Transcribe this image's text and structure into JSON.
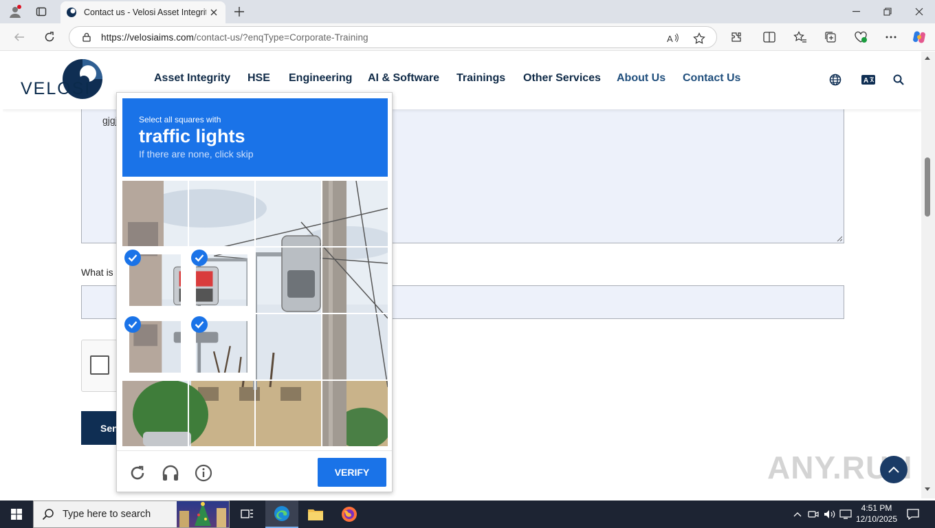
{
  "browser": {
    "tab_title": "Contact us - Velosi Asset Integrity",
    "url_host": "https://velosiaims.com",
    "url_path": "/contact-us/?enqType=Corporate-Training"
  },
  "site": {
    "logo_text": "VELOSI",
    "nav": [
      "Asset Integrity",
      "HSE",
      "Engineering",
      "AI & Software",
      "Trainings",
      "Other Services",
      "About Us",
      "Contact Us"
    ],
    "message_value": "gjgj",
    "question_label": "What is",
    "send_label": "Sen"
  },
  "captcha": {
    "instruction_small": "Select all squares with",
    "instruction_big": "traffic lights",
    "instruction_sub": "If there are none, click skip",
    "verify_label": "VERIFY",
    "selected_tiles": [
      4,
      5,
      8,
      9
    ]
  },
  "taskbar": {
    "search_placeholder": "Type here to search",
    "time": "4:51 PM",
    "date": "12/10/2025"
  },
  "watermark": "ANY.RUN",
  "colors": {
    "brand_navy": "#0f2e53",
    "captcha_blue": "#1a73e8",
    "field_bg": "#edf1fa"
  }
}
